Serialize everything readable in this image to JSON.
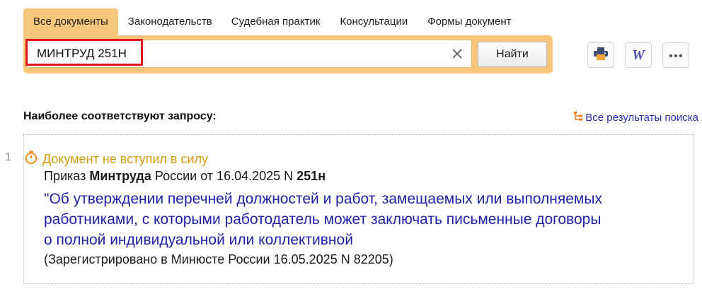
{
  "tabs": [
    {
      "label": "Все документы",
      "active": true
    },
    {
      "label": "Законодательств",
      "active": false
    },
    {
      "label": "Судебная практик",
      "active": false
    },
    {
      "label": "Консультации",
      "active": false
    },
    {
      "label": "Формы документ",
      "active": false
    }
  ],
  "search": {
    "value": "МИНТРУД 251Н",
    "find_label": "Найти",
    "clear_icon": "close-icon"
  },
  "toolbar": {
    "print_icon": "printer-icon",
    "word_icon": "word-export-icon",
    "word_glyph": "W",
    "more_icon": "more-dots-icon"
  },
  "results": {
    "heading": "Наиболее соответствуют запросу:",
    "all_results_label": "Все результаты поиска",
    "items": [
      {
        "number": "1",
        "status": "Документ не вступил в силу",
        "meta_prefix": "Приказ ",
        "meta_org": "Минтруда",
        "meta_mid": " России от 16.04.2025 N ",
        "meta_num": "251н",
        "title": "\"Об утверждении перечней должностей и работ, замещаемых или выполняемых работниками, с которыми работодатель может заключать письменные договоры о полной индивидуальной или коллективной",
        "note": "(Зарегистрировано в Минюсте России 16.05.2025 N 82205)"
      }
    ]
  },
  "colors": {
    "accent": "#f9c77c",
    "highlight": "#e0141e",
    "link": "#2020a8",
    "status": "#d89a10"
  }
}
